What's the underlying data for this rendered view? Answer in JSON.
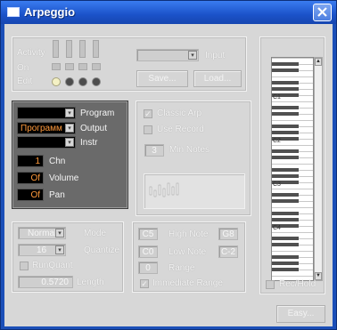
{
  "window": {
    "title": "Arpeggio"
  },
  "top": {
    "activity_label": "Activity",
    "on_label": "On",
    "edit_label": "Edit",
    "input_label": "Input",
    "save_label": "Save...",
    "load_label": "Load..."
  },
  "midi": {
    "program_label": "Program",
    "output_label": "Output",
    "output_value": "Программ",
    "instr_label": "Instr",
    "chn_label": "Chn",
    "chn_value": "1",
    "volume_label": "Volume",
    "volume_value": "Of",
    "pan_label": "Pan",
    "pan_value": "Of"
  },
  "arp": {
    "classic_label": "Classic Arp",
    "use_record_label": "Use Record",
    "min_notes_label": "Min Notes",
    "min_notes_value": "3"
  },
  "mode": {
    "mode_value": "Normal",
    "mode_label": "Mode",
    "quantize_value": "16",
    "quantize_label": "Quantize",
    "runquant_label": "RunQuant",
    "length_value": "0.5720",
    "length_label": "Length"
  },
  "range": {
    "high_label": "High Note",
    "high_from": "C5",
    "high_to": "G8",
    "low_label": "Low Note",
    "low_from": "C0",
    "low_to": "C-2",
    "range_label": "Range",
    "range_value": "0",
    "immediate_label": "Immediate Range"
  },
  "keyboard": {
    "c_labels": [
      "C1",
      "C2",
      "C3",
      "C4"
    ],
    "rec_hold_label": "Rec/Hold"
  },
  "footer": {
    "easy_label": "Easy..."
  },
  "colors": {
    "title_bar": "#1b52c9",
    "field_bg": "#000000",
    "field_text": "#ff9a3c"
  }
}
